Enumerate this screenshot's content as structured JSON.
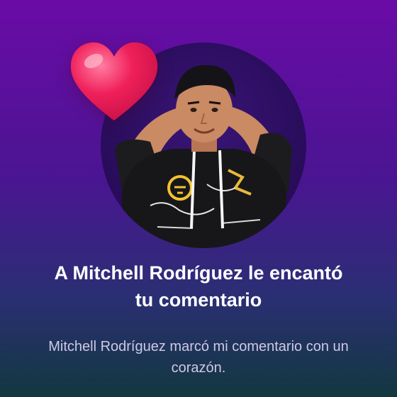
{
  "notification": {
    "title": "A Mitchell Rodríguez le encantó tu comentario",
    "subtitle": "Mitchell Rodríguez marcó mi comentario con un corazón."
  },
  "icons": {
    "heart": "heart-icon",
    "avatar": "user-avatar"
  },
  "colors": {
    "background_top": "#6a0ba6",
    "background_bottom": "#12383f",
    "heart": "#f0205a",
    "title": "#ffffff",
    "subtitle": "#cfc8e6"
  }
}
